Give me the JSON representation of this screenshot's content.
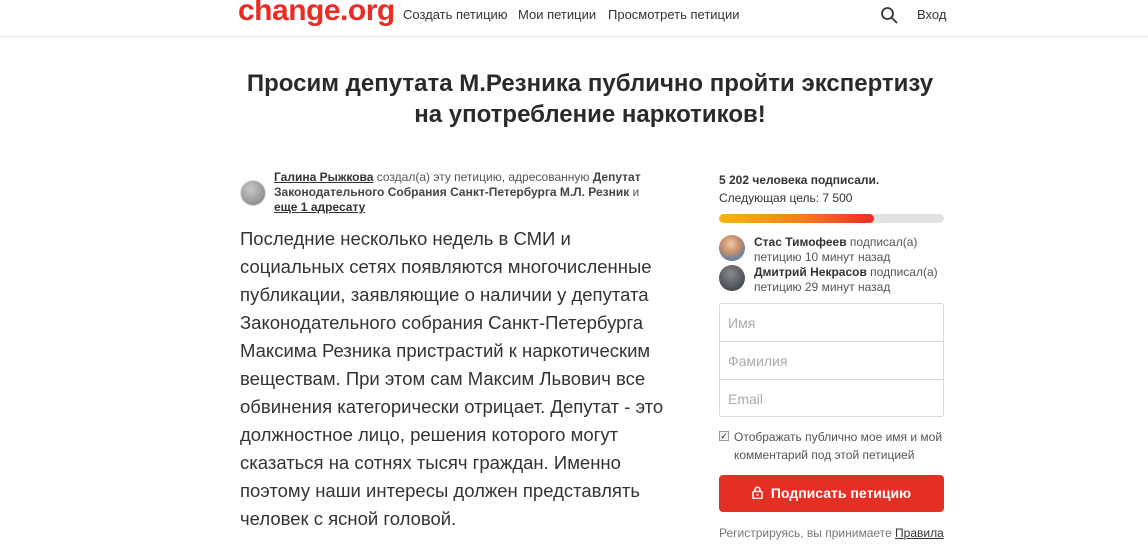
{
  "header": {
    "logo": "change.org",
    "nav": [
      "Создать петицию",
      "Мои петиции",
      "Просмотреть петиции"
    ],
    "login": "Вход",
    "search_icon": "search-icon"
  },
  "petition": {
    "title_line1": "Просим депутата М.Резника публично пройти экспертизу",
    "title_line2": "на употребление наркотиков!",
    "author_name": "Галина Рыжкова",
    "author_text": " создал(а) эту петицию, адресованную ",
    "addressee": "Депутат Законодательного Собрания Санкт-Петербурга М.Л. Резник",
    "conj": " и ",
    "more_addressees": "еще 1 адресату",
    "body": "Последние несколько недель в СМИ и социальных сетях появляются многочисленные публикации, заявляющие о наличии у депутата Законодательного собрания Санкт-Петербурга Максима Резника пристрастий к наркотическим веществам. При этом сам Максим Львович все обвинения категорически отрицает. Депутат - это должностное лицо, решения которого могут сказаться на сотнях тысяч граждан. Именно поэтому наши интересы должен представлять человек с ясной головой."
  },
  "sidebar": {
    "sign_count": "5 202 человека подписали.",
    "next_goal": "Следующая цель: 7 500",
    "progress": 0.69,
    "signers": [
      {
        "name": "Стас Тимофеев",
        "action": " подписал(а)",
        "time": "петицию 10 минут назад"
      },
      {
        "name": "Дмитрий Некрасов",
        "action": " подписал(а)",
        "time": "петицию 29 минут назад"
      }
    ],
    "form": {
      "first_name_placeholder": "Имя",
      "last_name_placeholder": "Фамилия",
      "email_placeholder": "Email"
    },
    "checkbox_checked": true,
    "checkbox_label": "Отображать публично мое имя и мой комментарий под этой петицией",
    "sign_button": "Подписать петицию",
    "terms_text": "Регистрируясь, вы принимаете ",
    "terms_link": "Правила"
  },
  "colors": {
    "brand": "#ec2c22",
    "button": "#e62f24"
  }
}
